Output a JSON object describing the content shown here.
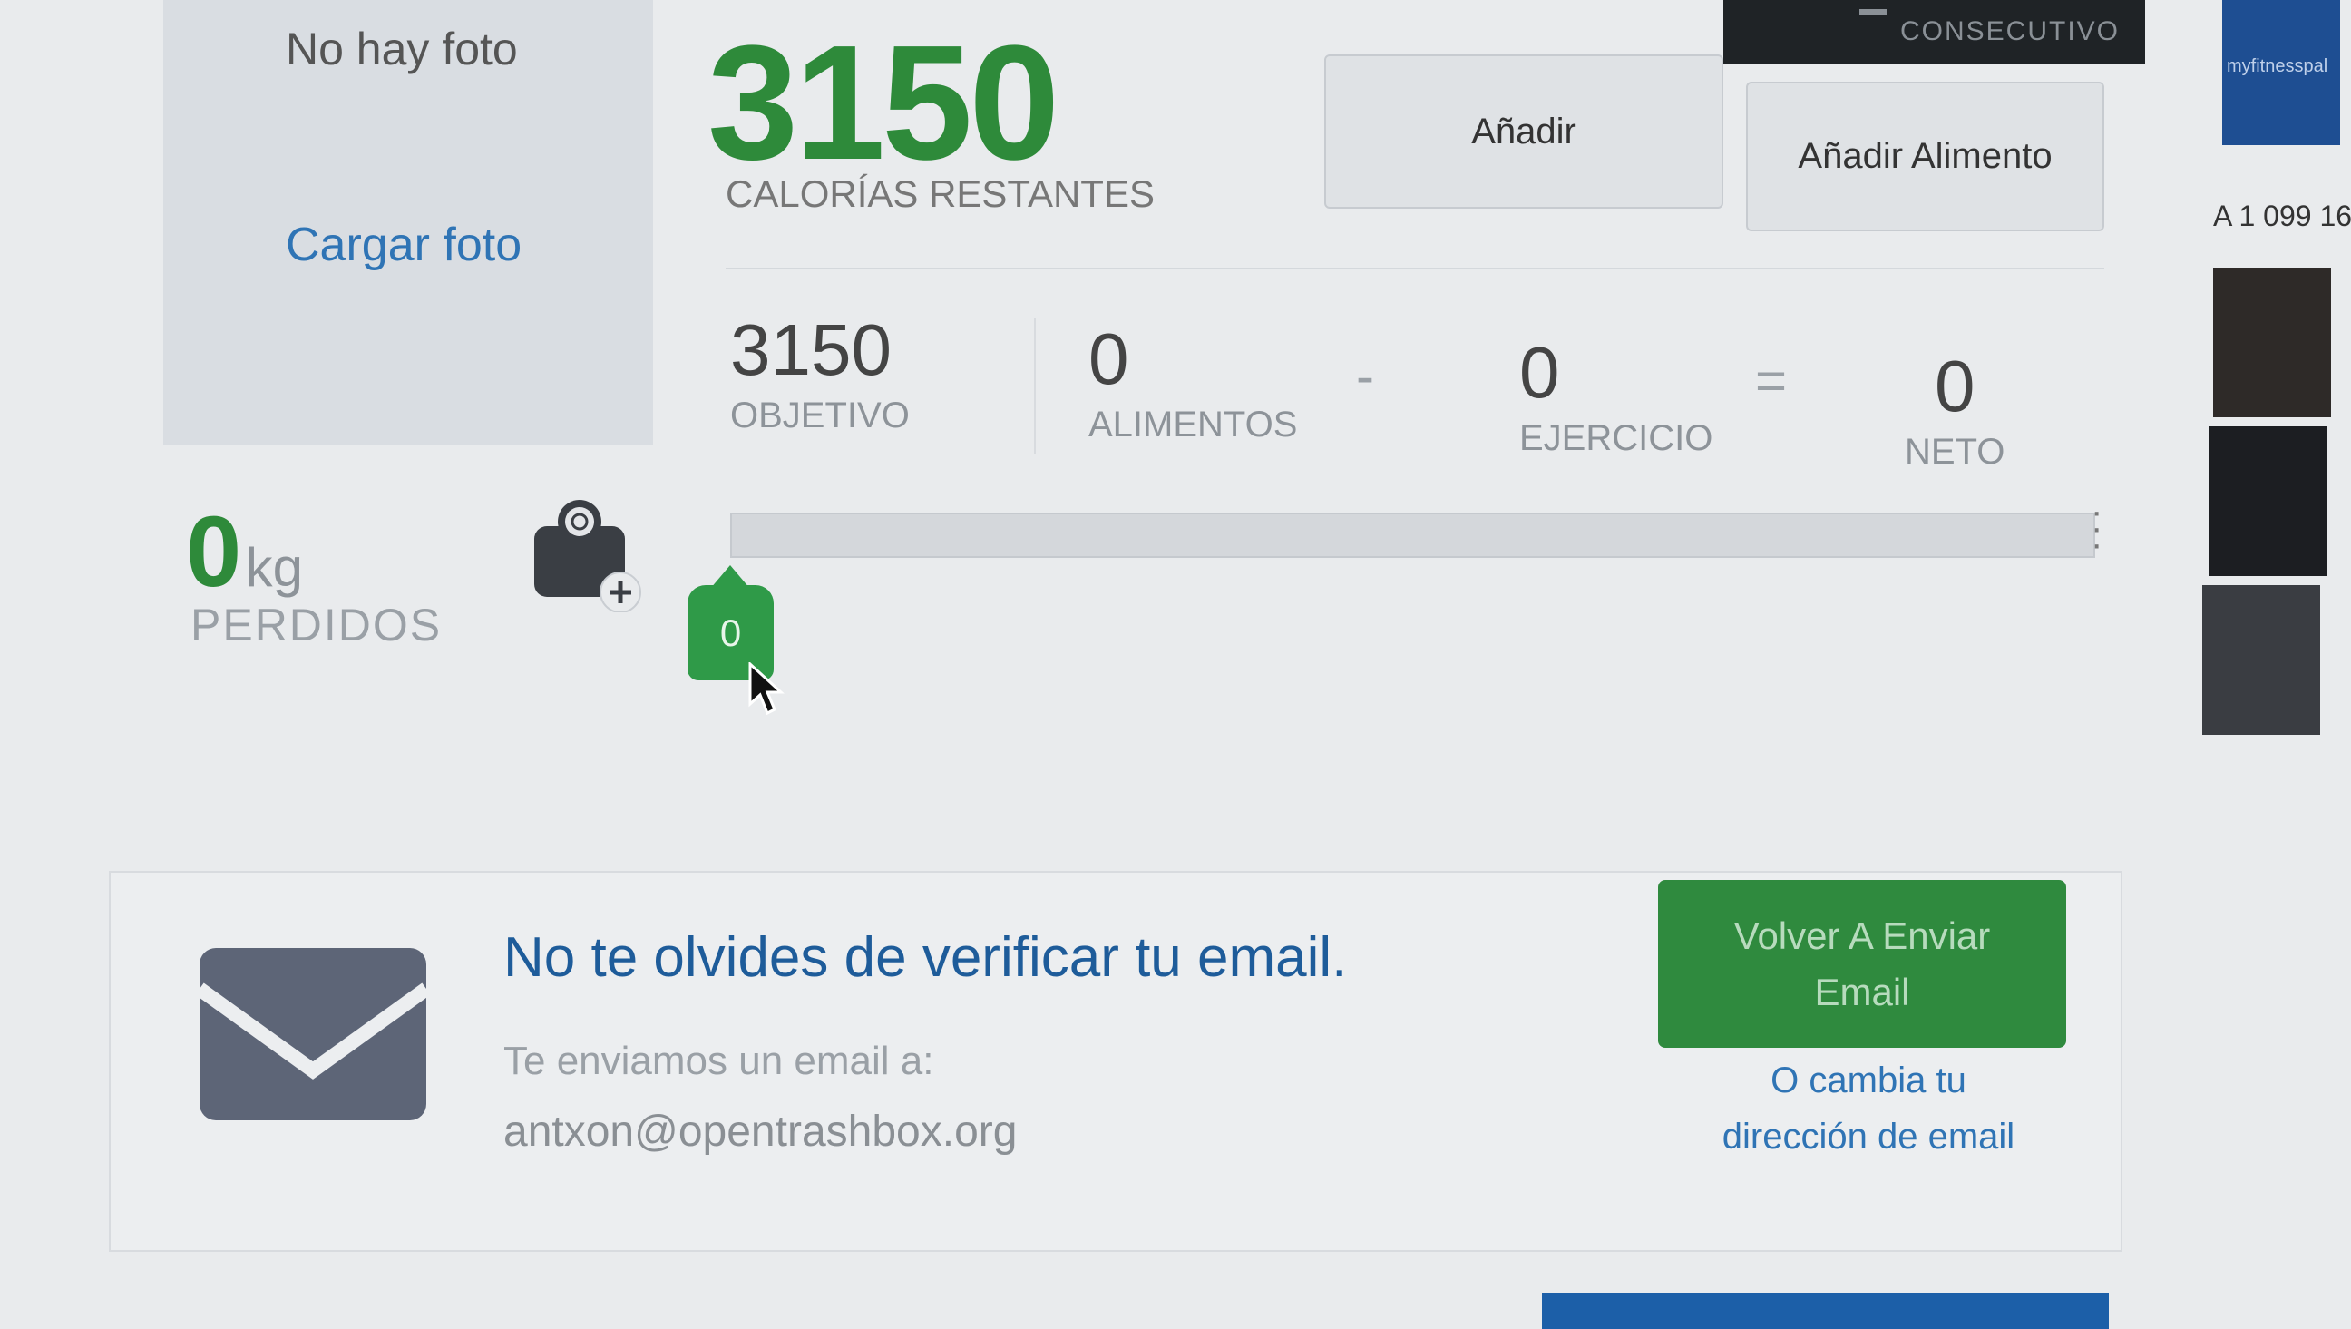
{
  "topbar": {
    "label": "CONSECUTIVO"
  },
  "photo": {
    "no_photo": "No hay foto",
    "upload_link": "Cargar foto"
  },
  "calories": {
    "remaining": "3150",
    "remaining_label": "CALORÍAS RESTANTES"
  },
  "actions": {
    "add": "Añadir",
    "add_food": "Añadir Alimento"
  },
  "equation": {
    "goal": {
      "value": "3150",
      "label": "OBJETIVO"
    },
    "food": {
      "value": "0",
      "label": "ALIMENTOS"
    },
    "minus": "-",
    "exercise": {
      "value": "0",
      "label": "EJERCICIO"
    },
    "equals": "=",
    "net": {
      "value": "0",
      "label": "NETO"
    }
  },
  "progress": {
    "fraction": 0,
    "marker_value": "0"
  },
  "weight": {
    "value": "0",
    "unit": "kg",
    "label": "PERDIDOS"
  },
  "email_verify": {
    "title": "No te olvides de verificar tu email.",
    "subtitle": "Te enviamos un email a:",
    "email": "antxon@opentrashbox.org",
    "resend_line1": "Volver A Enviar",
    "resend_line2": "Email",
    "change_line1": "O cambia tu",
    "change_line2": "dirección de email"
  },
  "sidebar": {
    "brand": "myfitnesspal",
    "count_text": "A 1 099 16"
  },
  "colors": {
    "green": "#2e8a3a",
    "link_blue": "#2f74b5",
    "title_blue": "#1e5c9a"
  }
}
